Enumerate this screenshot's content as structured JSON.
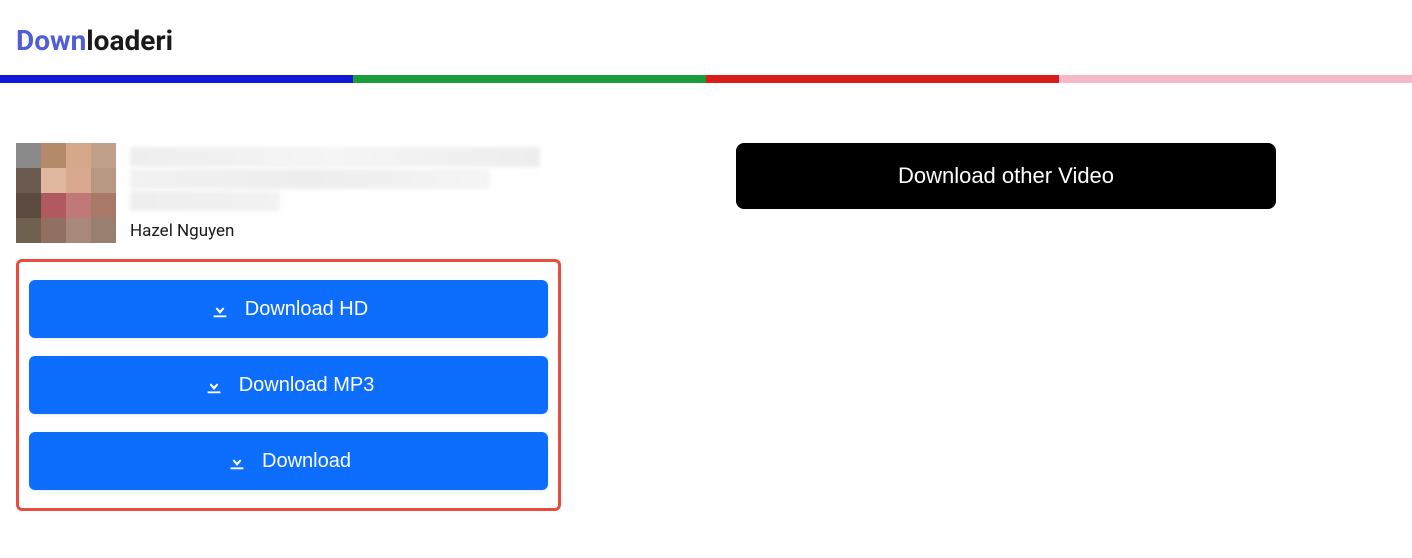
{
  "logo": {
    "prefix": "Down",
    "suffix": "loaderi"
  },
  "colorBar": {
    "blue": "#0f18d6",
    "green": "#1a9e3b",
    "red": "#d81b1b",
    "pink": "#f4b8c8"
  },
  "video": {
    "author": "Hazel Nguyen"
  },
  "buttons": {
    "download_hd": "Download HD",
    "download_mp3": "Download MP3",
    "download": "Download",
    "download_other": "Download other Video"
  }
}
